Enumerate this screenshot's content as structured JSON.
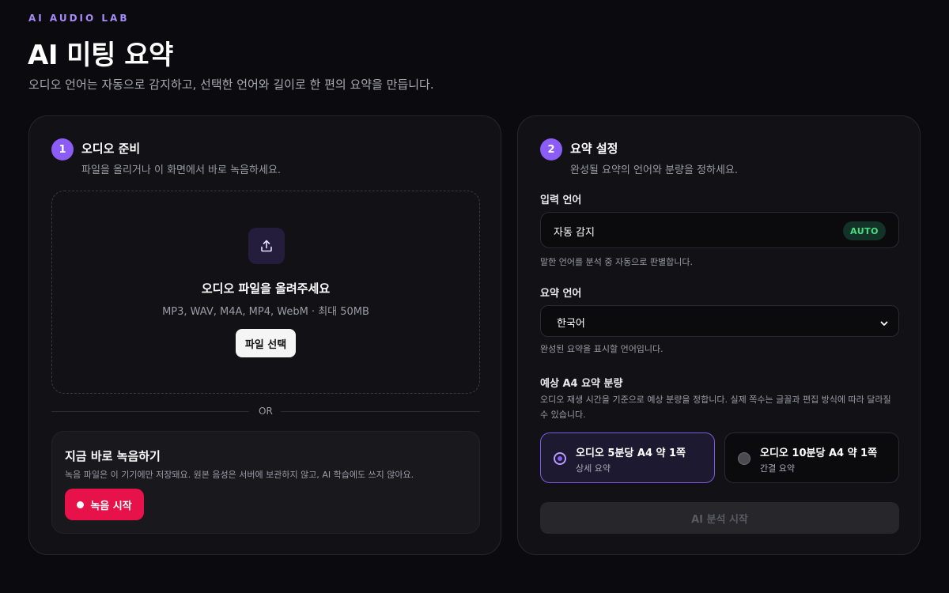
{
  "header": {
    "eyebrow": "AI AUDIO LAB",
    "title": "AI 미팅 요약",
    "subtitle": "오디오 언어는 자동으로 감지하고, 선택한 언어와 길이로 한 편의 요약을 만듭니다."
  },
  "audio_card": {
    "step_number": "1",
    "title": "오디오 준비",
    "description": "파일을 올리거나 이 화면에서 바로 녹음하세요.",
    "dropzone": {
      "icon": "upload-icon",
      "title": "오디오 파일을 올려주세요",
      "formats": "MP3, WAV, M4A, MP4, WebM · 최대 50MB",
      "button_label": "파일 선택"
    },
    "divider_label": "OR",
    "record": {
      "title": "지금 바로 녹음하기",
      "description": "녹음 파일은 이 기기에만 저장돼요. 원본 음성은 서버에 보관하지 않고, AI 학습에도 쓰지 않아요.",
      "button_label": "녹음 시작"
    }
  },
  "settings_card": {
    "step_number": "2",
    "title": "요약 설정",
    "description": "완성될 요약의 언어와 분량을 정하세요.",
    "input_language": {
      "label": "입력 언어",
      "value": "자동 감지",
      "badge": "AUTO",
      "help": "말한 언어를 분석 중 자동으로 판별합니다."
    },
    "summary_language": {
      "label": "요약 언어",
      "selected": "한국어",
      "help": "완성된 요약을 표시할 언어입니다."
    },
    "length": {
      "label": "예상 A4 요약 분량",
      "help": "오디오 재생 시간을 기준으로 예상 분량을 정합니다. 실제 쪽수는 글꼴과 편집 방식에 따라 달라질 수 있습니다.",
      "options": [
        {
          "title": "오디오 5분당 A4 약 1쪽",
          "subtitle": "상세 요약",
          "selected": true
        },
        {
          "title": "오디오 10분당 A4 약 1쪽",
          "subtitle": "간결 요약",
          "selected": false
        }
      ]
    },
    "submit_label": "AI 분석 시작"
  },
  "colors": {
    "background": "#0b0b0f",
    "accent": "#8b5cf6",
    "record": "#e8124a",
    "auto_badge": "#4ade80"
  }
}
